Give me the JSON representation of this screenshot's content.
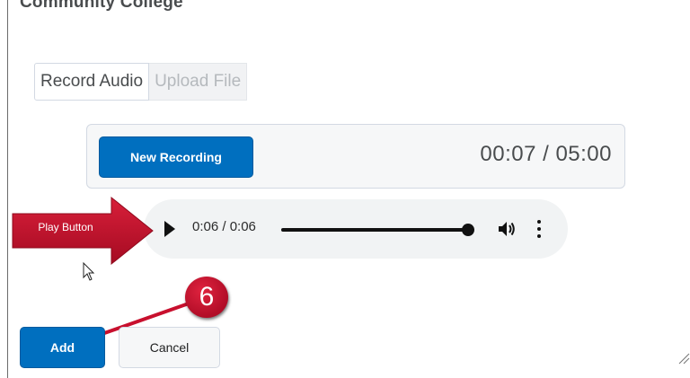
{
  "header": {
    "title_fragment": "Community College"
  },
  "tabs": [
    {
      "label": "Record Audio",
      "active": true
    },
    {
      "label": "Upload File",
      "active": false
    }
  ],
  "recorder": {
    "new_recording_label": "New Recording",
    "timer": "00:07 / 05:00"
  },
  "player": {
    "time_display": "0:06 / 0:06",
    "progress": 1.0,
    "play_icon": "play-icon",
    "volume_icon": "volume-icon",
    "more_icon": "more-vertical-icon"
  },
  "annotations": {
    "callout_label": "Play Button",
    "step_number": "6",
    "accent_color": "#c8102e"
  },
  "footer": {
    "add_label": "Add",
    "cancel_label": "Cancel"
  },
  "colors": {
    "primary": "#006fbf",
    "panel_bg": "#f6f7f8",
    "player_bg": "#f1f3f4"
  }
}
